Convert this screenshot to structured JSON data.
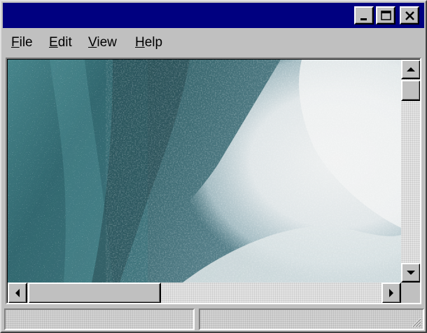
{
  "window": {
    "title": ""
  },
  "menubar": {
    "items": [
      {
        "id": "file",
        "label": "File"
      },
      {
        "id": "edit",
        "label": "Edit"
      },
      {
        "id": "view",
        "label": "View"
      },
      {
        "id": "help",
        "label": "Help"
      }
    ]
  },
  "titlebar_buttons": {
    "minimize": "minimize-icon",
    "maximize": "maximize-icon",
    "close": "close-icon"
  },
  "content": {
    "image": "ocean wave splash photograph"
  },
  "scroll": {
    "vertical_position": 0.0,
    "horizontal_position": 0.0
  },
  "statusbar": {
    "panes": [
      "",
      ""
    ]
  },
  "colors": {
    "titlebar": "#000080",
    "chrome": "#c0c0c0"
  }
}
